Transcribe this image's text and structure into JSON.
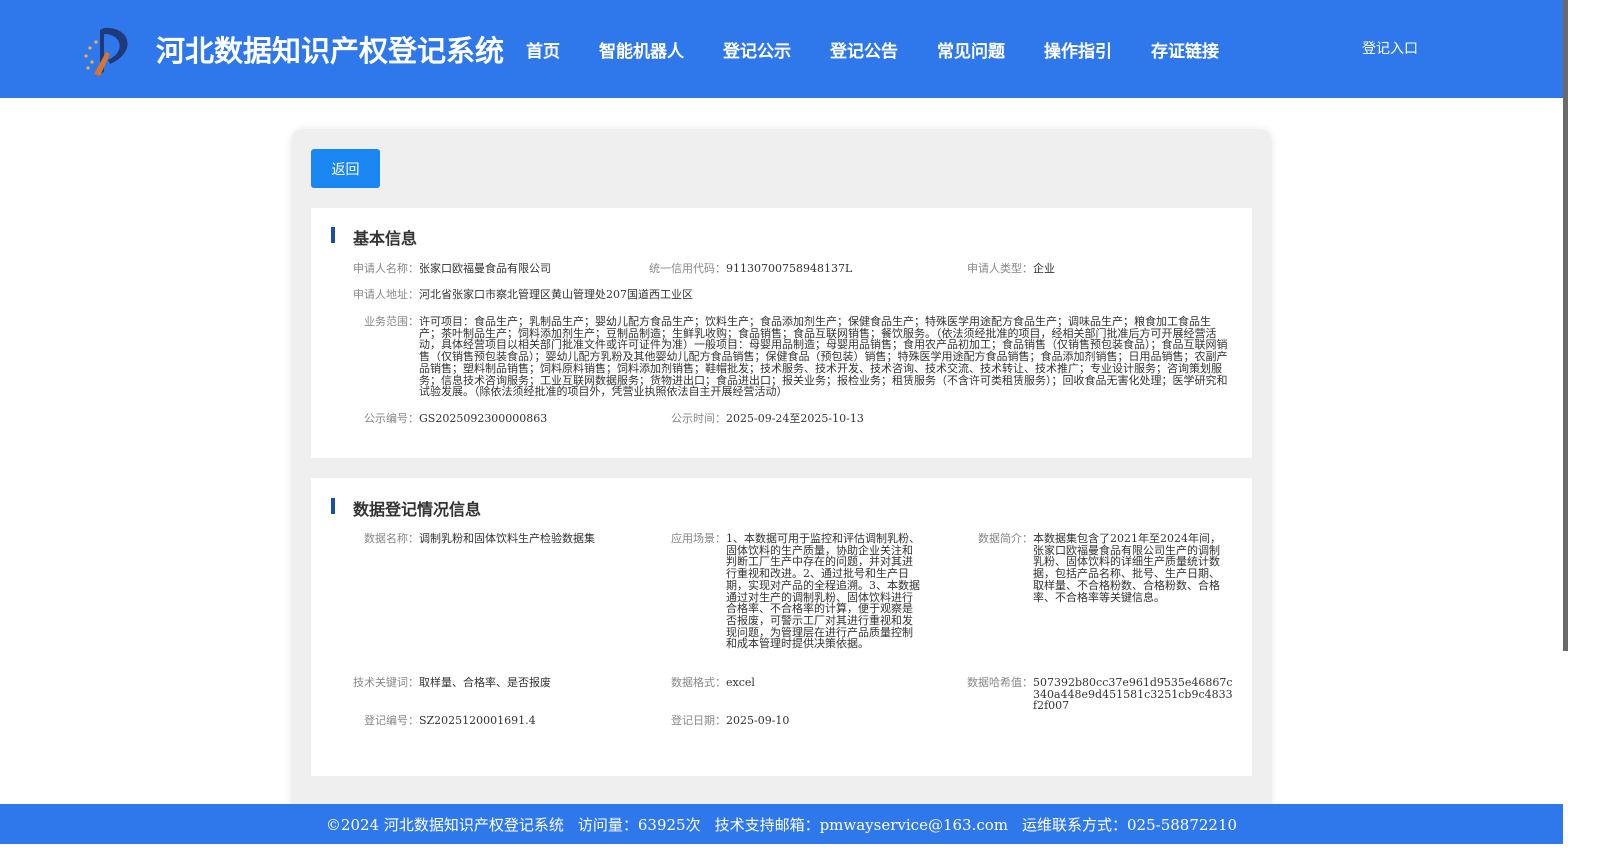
{
  "header": {
    "site_title": "河北数据知识产权登记系统",
    "nav": [
      "首页",
      "智能机器人",
      "登记公示",
      "登记公告",
      "常见问题",
      "操作指引",
      "存证链接"
    ],
    "login": "登记入口",
    "logo_icon": "institution-logo-icon",
    "bg_color": "#2f78ec"
  },
  "back_label": "返回",
  "basic_info": {
    "title": "基本信息",
    "applicant_name_label": "申请人名称：",
    "applicant_name": "张家口欧福曼食品有限公司",
    "credit_code_label": "统一信用代码：",
    "credit_code": "91130700758948137L",
    "applicant_type_label": "申请人类型：",
    "applicant_type": "企业",
    "address_label": "申请人地址：",
    "address": "河北省张家口市察北管理区黄山管理处207国道西工业区",
    "scope_label": "业务范围：",
    "scope": "许可项目：食品生产；乳制品生产；婴幼儿配方食品生产；饮料生产；食品添加剂生产；保健食品生产；特殊医学用途配方食品生产；调味品生产；粮食加工食品生产；茶叶制品生产；饲料添加剂生产；豆制品制造；生鲜乳收购；食品销售；食品互联网销售；餐饮服务。（依法须经批准的项目，经相关部门批准后方可开展经营活动，具体经营项目以相关部门批准文件或许可证件为准）一般项目：母婴用品制造；母婴用品销售；食用农产品初加工；食品销售（仅销售预包装食品）；食品互联网销售（仅销售预包装食品）；婴幼儿配方乳粉及其他婴幼儿配方食品销售；保健食品（预包装）销售；特殊医学用途配方食品销售；食品添加剂销售；日用品销售；农副产品销售；塑料制品销售；饲料原料销售；饲料添加剂销售；鞋帽批发；技术服务、技术开发、技术咨询、技术交流、技术转让、技术推广；专业设计服务；咨询策划服务；信息技术咨询服务；工业互联网数据服务；货物进出口；食品进出口；报关业务；报检业务；租赁服务（不含许可类租赁服务）；回收食品无害化处理；医学研究和试验发展。（除依法须经批准的项目外，凭营业执照依法自主开展经营活动）",
    "pub_no_label": "公示编号：",
    "pub_no": "GS2025092300000863",
    "pub_time_label": "公示时间：",
    "pub_time": "2025-09-24至2025-10-13"
  },
  "data_info": {
    "title": "数据登记情况信息",
    "data_name_label": "数据名称：",
    "data_name": "调制乳粉和固体饮料生产检验数据集",
    "scenario_label": "应用场景：",
    "scenario": "1、本数据可用于监控和评估调制乳粉、固体饮料的生产质量，协助企业关注和判断工厂生产中存在的问题，并对其进行重视和改进。2、通过批号和生产日期，实现对产品的全程追溯。3、本数据通过对生产的调制乳粉、固体饮料进行合格率、不合格率的计算，便于观察是否报废，可警示工厂对其进行重视和发现问题，为管理层在进行产品质量控制和成本管理时提供决策依据。",
    "summary_label": "数据简介：",
    "summary": "本数据集包含了2021年至2024年间，张家口欧福曼食品有限公司生产的调制乳粉、固体饮料的详细生产质量统计数据，包括产品名称、批号、生产日期、取样量、不合格粉数、合格粉数、合格率、不合格率等关键信息。",
    "keywords_label": "技术关键词：",
    "keywords": "取样量、合格率、是否报废",
    "format_label": "数据格式：",
    "format": "excel",
    "hash_label": "数据哈希值：",
    "hash": "507392b80cc37e961d9535e46867c340a448e9d451581c3251cb9c4833f2f007",
    "reg_no_label": "登记编号：",
    "reg_no": "SZ2025120001691.4",
    "reg_date_label": "登记日期：",
    "reg_date": "2025-09-10"
  },
  "footer": {
    "copyright": "©2024 河北数据知识产权登记系统",
    "visits": "访问量：63925次",
    "email": "技术支持邮箱：pmwayservice@163.com",
    "phone": "运维联系方式：025-58872210"
  }
}
